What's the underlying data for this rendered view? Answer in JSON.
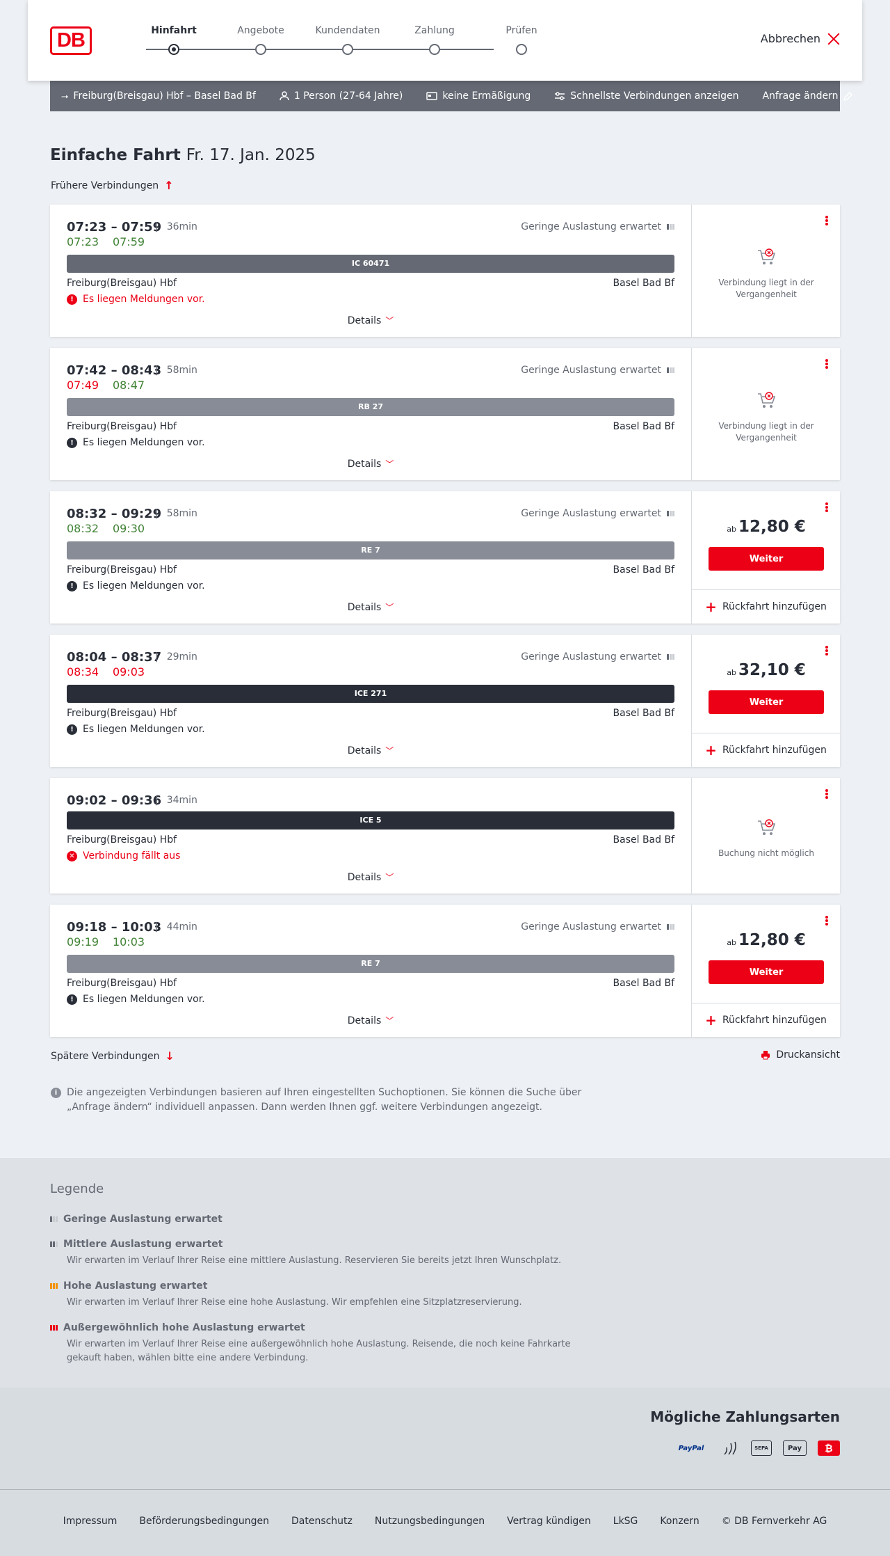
{
  "header": {
    "logo": "DB",
    "steps": [
      "Hinfahrt",
      "Angebote",
      "Kundendaten",
      "Zahlung",
      "Prüfen"
    ],
    "cancel": "Abbrechen"
  },
  "searchbar": {
    "route": "Freiburg(Breisgau) Hbf – Basel Bad Bf",
    "persons": "1 Person (27-64 Jahre)",
    "discount": "keine Ermäßigung",
    "fastest": "Schnellste Verbindungen anzeigen",
    "change": "Anfrage ändern"
  },
  "page": {
    "title": "Einfache Fahrt",
    "date": "Fr. 17. Jan. 2025",
    "earlier": "Frühere Verbindungen",
    "later": "Spätere Verbindungen",
    "print": "Druckansicht",
    "info": "Die angezeigten Verbindungen basieren auf Ihren eingestellten Suchoptionen. Sie können die Suche über „Anfrage ändern“ individuell anpassen. Dann werden Ihnen ggf. weitere Verbindungen angezeigt."
  },
  "common": {
    "load": "Geringe Auslastung erwartet",
    "details": "Details",
    "ab": "ab",
    "weiter": "Weiter",
    "return": "Rückfahrt hinzufügen",
    "past": "Verbindung liegt in der Vergangenheit",
    "not_possible": "Buchung nicht möglich"
  },
  "connections": [
    {
      "times": "07:23 – 07:59",
      "duration": "36min",
      "rt_dep": "07:23",
      "rt_arr": "07:59",
      "train": "IC 60471",
      "from": "Freiburg(Breisgau) Hbf",
      "to": "Basel Bad Bf",
      "message": "Es liegen Meldungen vor."
    },
    {
      "times": "07:42 – 08:43",
      "duration": "58min",
      "rt_dep": "07:49",
      "rt_arr": "08:47",
      "train": "RB 27",
      "from": "Freiburg(Breisgau) Hbf",
      "to": "Basel Bad Bf",
      "message": "Es liegen Meldungen vor."
    },
    {
      "times": "08:32 – 09:29",
      "duration": "58min",
      "rt_dep": "08:32",
      "rt_arr": "09:30",
      "train": "RE 7",
      "from": "Freiburg(Breisgau) Hbf",
      "to": "Basel Bad Bf",
      "message": "Es liegen Meldungen vor.",
      "price": "12,80 €"
    },
    {
      "times": "08:04 – 08:37",
      "duration": "29min",
      "rt_dep": "08:34",
      "rt_arr": "09:03",
      "train": "ICE 271",
      "from": "Freiburg(Breisgau) Hbf",
      "to": "Basel Bad Bf",
      "message": "Es liegen Meldungen vor.",
      "price": "32,10 €"
    },
    {
      "times": "09:02 – 09:36",
      "duration": "34min",
      "train": "ICE 5",
      "from": "Freiburg(Breisgau) Hbf",
      "to": "Basel Bad Bf",
      "message": "Verbindung fällt aus"
    },
    {
      "times": "09:18 – 10:03",
      "duration": "44min",
      "rt_dep": "09:19",
      "rt_arr": "10:03",
      "train": "RE 7",
      "from": "Freiburg(Breisgau) Hbf",
      "to": "Basel Bad Bf",
      "message": "Es liegen Meldungen vor.",
      "price": "12,80 €"
    }
  ],
  "legend": {
    "title": "Legende",
    "items": [
      {
        "title": "Geringe Auslastung erwartet",
        "desc": ""
      },
      {
        "title": "Mittlere Auslastung erwartet",
        "desc": "Wir erwarten im Verlauf Ihrer Reise eine mittlere Auslastung. Reservieren Sie bereits jetzt Ihren Wunschplatz."
      },
      {
        "title": "Hohe Auslastung erwartet",
        "desc": "Wir erwarten im Verlauf Ihrer Reise eine hohe Auslastung. Wir empfehlen eine Sitzplatzreservierung."
      },
      {
        "title": "Außergewöhnlich hohe Auslastung erwartet",
        "desc": "Wir erwarten im Verlauf Ihrer Reise eine außergewöhnlich hohe Auslastung. Reisende, die noch keine Fahrkarte gekauft haben, wählen bitte eine andere Verbindung."
      }
    ]
  },
  "payment": {
    "title": "Mögliche Zahlungsarten",
    "paypal": "PayPal",
    "sepa": "SEPA",
    "applepay": "Pay"
  },
  "footer": [
    "Impressum",
    "Beförderungsbedingungen",
    "Datenschutz",
    "Nutzungsbedingungen",
    "Vertrag kündigen",
    "LkSG",
    "Konzern",
    "© DB Fernverkehr AG"
  ],
  "colors": {
    "accent": "#ec0016",
    "ontime": "#408335",
    "train_dark": "#282d37",
    "train_mid": "#646973",
    "train_light": "#878c96"
  }
}
